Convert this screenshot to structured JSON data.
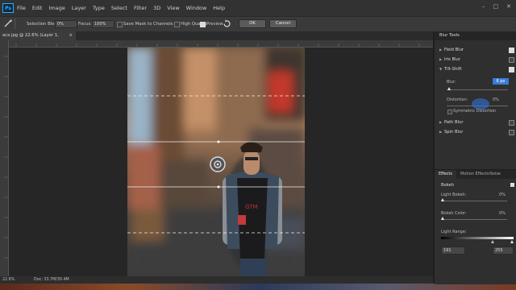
{
  "menubar": {
    "logo": "Ps",
    "items": [
      "File",
      "Edit",
      "Image",
      "Layer",
      "Type",
      "Select",
      "Filter",
      "3D",
      "View",
      "Window",
      "Help"
    ],
    "window_controls": [
      "–",
      "□",
      "✕"
    ]
  },
  "options": {
    "selection_bleed_label": "Selection Bleed:",
    "selection_bleed_value": "0%",
    "focus_label": "Focus:",
    "focus_value": "100%",
    "save_mask_label": "Save Mask to Channels",
    "high_quality_label": "High Quality",
    "preview_label": "Preview",
    "ok_label": "OK",
    "cancel_label": "Cancel"
  },
  "document": {
    "tab_title": "acx.jpg @ 22.6% (Layer 1, RGB/8#) *",
    "close_glyph": "×"
  },
  "status": {
    "zoom": "22.6%",
    "doc_info": "Doc: 33.7M/30.4M"
  },
  "blur_tools": {
    "header": "Blur Tools",
    "field_blur": "Field Blur",
    "iris_blur": "Iris Blur",
    "tilt_shift": "Tilt-Shift",
    "blur_label": "Blur:",
    "blur_value": "6 px",
    "distortion_label": "Distortion:",
    "distortion_value": "0%",
    "symmetric_label": "Symmetric Distortion",
    "path_blur": "Path Blur",
    "spin_blur": "Spin Blur"
  },
  "effects": {
    "tabs": [
      "Effects",
      "Motion Effects",
      "Noise"
    ],
    "bokeh_label": "Bokeh",
    "light_bokeh_label": "Light Bokeh:",
    "light_bokeh_value": "0%",
    "bokeh_color_label": "Bokeh Color:",
    "bokeh_color_value": "0%",
    "light_range_label": "Light Range:",
    "light_range_min": "191",
    "light_range_max": "255"
  },
  "photo": {
    "shirt_text": "GTM"
  },
  "colors": {
    "accent": "#31a8ff",
    "panel": "#2f2f2f",
    "menubar": "#323232"
  }
}
